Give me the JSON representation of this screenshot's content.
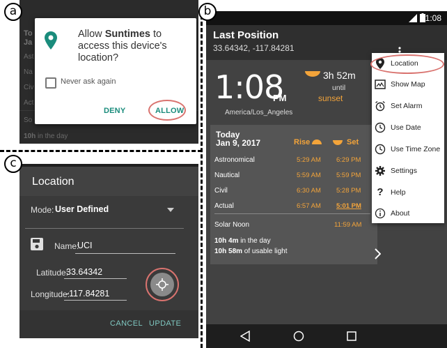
{
  "panels": {
    "a": "a",
    "b": "b",
    "c": "c"
  },
  "dialog": {
    "bg_title": "To",
    "bg_title2": "Ja",
    "bg_rows": [
      "Ast",
      "Na",
      "Civ",
      "Act",
      "So"
    ],
    "bg_footer_bold": "10h",
    "bg_footer": " in the day",
    "title_pre": "Allow ",
    "title_app": "Suntimes",
    "title_post": " to access this device's location?",
    "checkbox_label": "Never ask again",
    "deny": "DENY",
    "allow": "ALLOW"
  },
  "location_dialog": {
    "title": "Location",
    "mode_label": "Mode:",
    "mode_value": "User Defined",
    "name_label": "Name:",
    "name_value": "UCI",
    "latitude_label": "Latitude:",
    "latitude_value": "33.64342",
    "longitude_label": "Longitude:",
    "longitude_value": "-117.84281",
    "cancel": "CANCEL",
    "update": "UPDATE"
  },
  "app": {
    "status_time": "1:08",
    "title": "Last Position",
    "subtitle": "33.64342, -117.84281",
    "clock_time": "1:08",
    "clock_ampm": "PM",
    "timezone": "America/Los_Angeles",
    "until_duration": "3h 52m",
    "until_label": "until",
    "until_event": "sunset",
    "card": {
      "day": "Today",
      "date": "Jan 9, 2017",
      "rise_header": "Rise",
      "set_header": "Set",
      "rows": [
        {
          "label": "Astronomical",
          "rise": "5:29 AM",
          "set": "6:29 PM"
        },
        {
          "label": "Nautical",
          "rise": "5:59 AM",
          "set": "5:59 PM"
        },
        {
          "label": "Civil",
          "rise": "6:30 AM",
          "set": "5:28 PM"
        },
        {
          "label": "Actual",
          "rise": "6:57 AM",
          "set": "5:01 PM"
        }
      ],
      "noon_label": "Solar Noon",
      "noon_value": "11:59 AM",
      "day_length_bold": "10h 4m",
      "day_length_text": " in the day",
      "light_length_bold": "10h 58m",
      "light_length_text": " of usable light"
    },
    "menu": [
      "Location",
      "Show Map",
      "Set Alarm",
      "Use Date",
      "Use Time Zone",
      "Settings",
      "Help",
      "About"
    ]
  },
  "colors": {
    "accent": "#f3a43a",
    "teal": "#1a8c7c",
    "highlight": "#d9736f"
  }
}
